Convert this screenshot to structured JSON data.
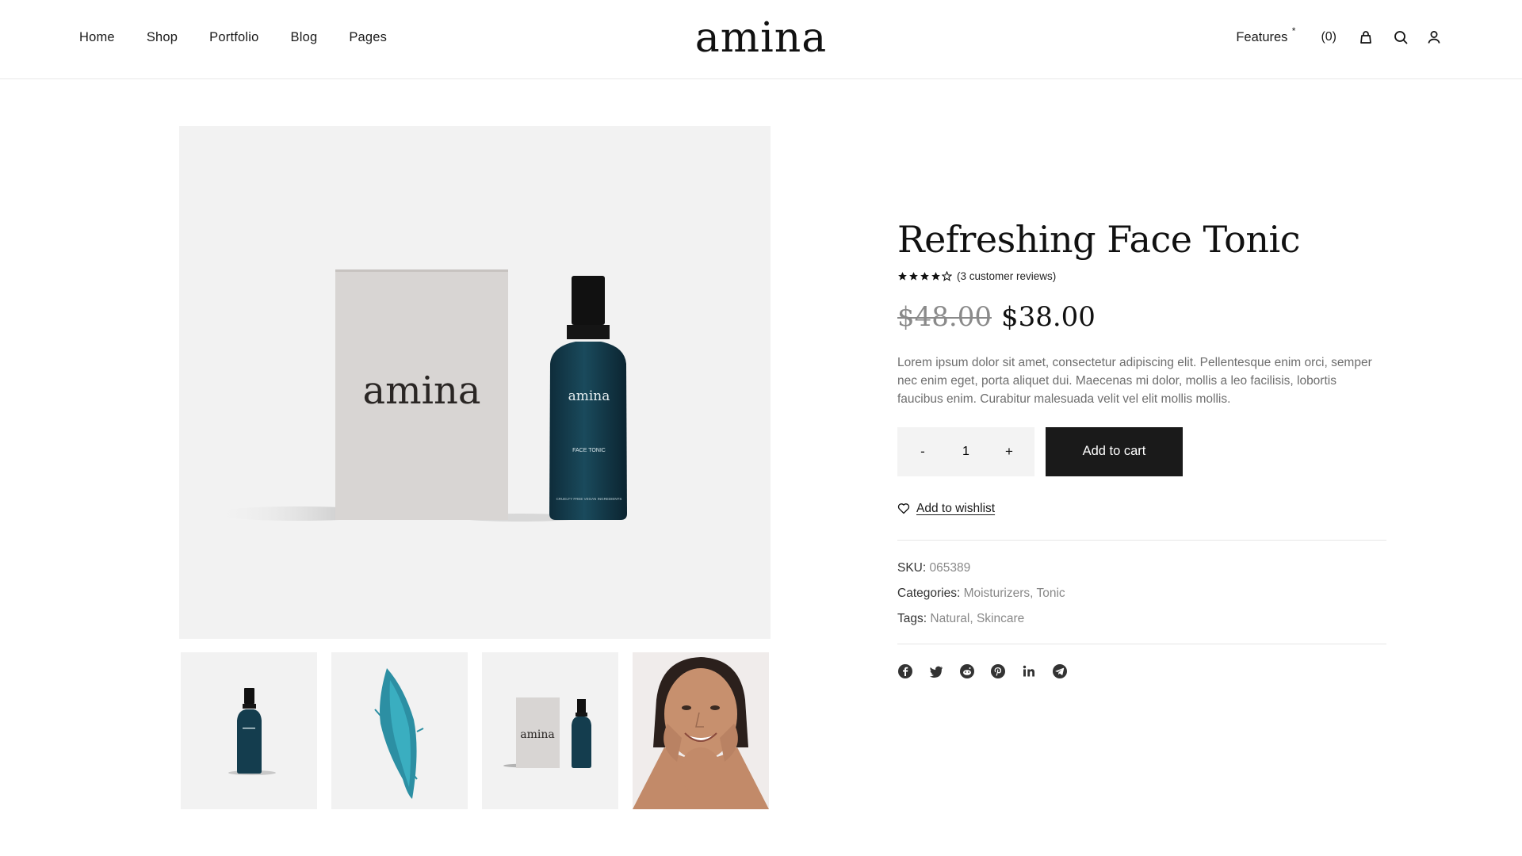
{
  "header": {
    "nav": [
      "Home",
      "Shop",
      "Portfolio",
      "Blog",
      "Pages"
    ],
    "logo": "amina",
    "features": "Features",
    "features_mark": "*",
    "cart_count": "(0)"
  },
  "gallery": {
    "main_box_logo": "amina",
    "main_bottle_logo": "amina",
    "main_bottle_label": "FACE TONIC",
    "main_bottle_small": "CRUELTY FREE VEGAN INGREDIENTS"
  },
  "product": {
    "title": "Refreshing Face Tonic",
    "rating_value": 4,
    "rating_max": 5,
    "reviews": "(3 customer reviews)",
    "old_price": "$48.00",
    "new_price": "$38.00",
    "description": "Lorem ipsum dolor sit amet, consectetur adipiscing elit. Pellentesque enim orci, semper nec enim eget, porta aliquet dui. Maecenas mi dolor, mollis a leo facilisis, lobortis faucibus enim. Curabitur malesuada velit vel elit mollis mollis.",
    "qty_minus": "-",
    "qty_value": "1",
    "qty_plus": "+",
    "add_to_cart": "Add to cart",
    "wishlist": "Add to wishlist",
    "sku_label": "SKU:",
    "sku": "065389",
    "categories_label": "Categories:",
    "categories": [
      "Moisturizers",
      "Tonic"
    ],
    "tags_label": "Tags:",
    "tags": [
      "Natural",
      "Skincare"
    ],
    "share_icons": [
      "facebook-icon",
      "twitter-icon",
      "reddit-icon",
      "pinterest-icon",
      "linkedin-icon",
      "telegram-icon"
    ]
  },
  "colors": {
    "accent_dark": "#1a1a1a",
    "bottle_teal": "#123b4c",
    "muted_text": "#6e6e6e"
  }
}
